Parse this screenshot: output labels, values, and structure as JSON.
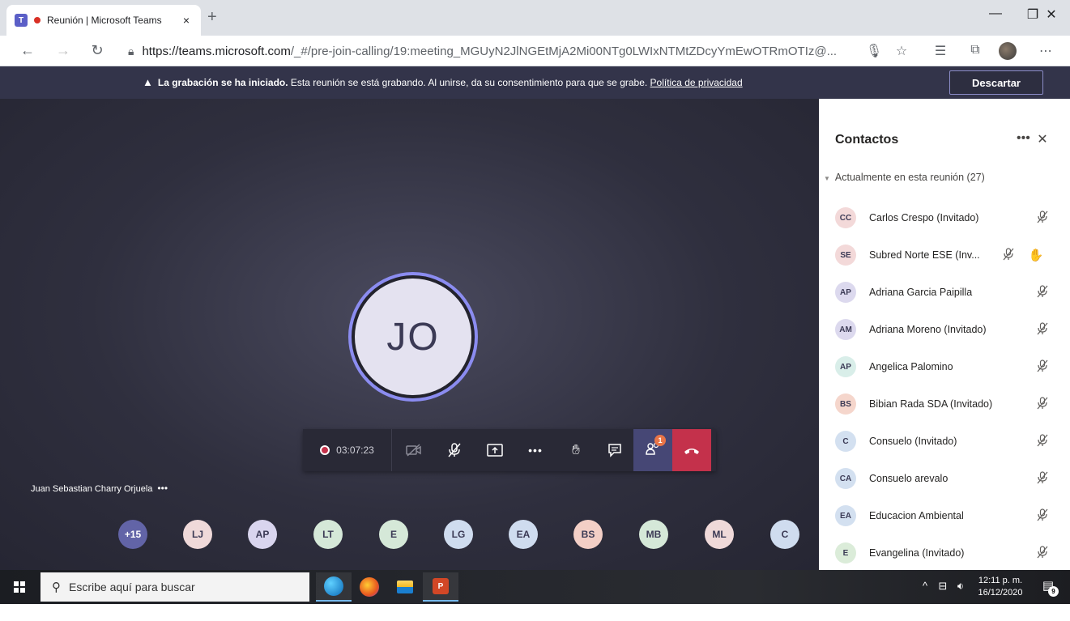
{
  "browser": {
    "tab_title": "Reunión | Microsoft Teams",
    "tab_close": "×",
    "new_tab": "+",
    "url_host": "https://teams.microsoft.com",
    "url_path": "/_#/pre-join-calling/19:meeting_MGUyN2JlNGEtMjA2Mi00NTg0LWIxNTMtZDcyYmEwOTRmOTIz@...",
    "icons": [
      "back-icon",
      "forward-icon",
      "refresh-icon",
      "lock-icon",
      "microphone-icon",
      "star-icon",
      "favorites-icon",
      "collections-icon",
      "more-icon"
    ]
  },
  "banner": {
    "bold_text": "La grabación se ha iniciado.",
    "text": " Esta reunión se está grabando. Al unirse, da su consentimiento para que se grabe. ",
    "link": "Política de privacidad",
    "dismiss_label": "Descartar"
  },
  "meeting": {
    "main_initials": "JO",
    "timer": "03:07:23",
    "people_badge": "1",
    "presenter_name": "Juan Sebastian Charry Orjuela",
    "presenter_more": "•••",
    "roster": [
      {
        "initials": "+15",
        "color": "#6264a7",
        "text_color": "#ffffff"
      },
      {
        "initials": "LJ",
        "color": "#efd9d9",
        "text_color": "#3b3a55"
      },
      {
        "initials": "AP",
        "color": "#d9d5ee",
        "text_color": "#3b3a55"
      },
      {
        "initials": "LT",
        "color": "#d5e8d8",
        "text_color": "#3b3a55"
      },
      {
        "initials": "E",
        "color": "#d5e8d8",
        "text_color": "#3b3a55"
      },
      {
        "initials": "LG",
        "color": "#cfdcef",
        "text_color": "#3b3a55"
      },
      {
        "initials": "EA",
        "color": "#cfdcef",
        "text_color": "#3b3a55"
      },
      {
        "initials": "BS",
        "color": "#f3cfc6",
        "text_color": "#3b3a55"
      },
      {
        "initials": "MB",
        "color": "#d5e8d8",
        "text_color": "#3b3a55"
      },
      {
        "initials": "ML",
        "color": "#efd9d9",
        "text_color": "#3b3a55"
      },
      {
        "initials": "C",
        "color": "#cfdcef",
        "text_color": "#3b3a55"
      }
    ]
  },
  "panel": {
    "title": "Contactos",
    "more": "•••",
    "close": "✕",
    "section": "Actualmente en esta reunión (27)",
    "participants": [
      {
        "initials": "CC",
        "name": "Carlos Crespo (Invitado)",
        "color": "#f3d9d9"
      },
      {
        "initials": "SE",
        "name": "Subred Norte ESE (Inv...",
        "color": "#f3d9d9"
      },
      {
        "initials": "AP",
        "name": "Adriana Garcia Paipilla",
        "color": "#dcd9ee"
      },
      {
        "initials": "AM",
        "name": "Adriana Moreno (Invitado)",
        "color": "#dcd9ee"
      },
      {
        "initials": "AP",
        "name": "Angelica Palomino",
        "color": "#d9eee9"
      },
      {
        "initials": "BS",
        "name": "Bibian Rada SDA (Invitado)",
        "color": "#f5d6cc"
      },
      {
        "initials": "C",
        "name": "Consuelo (Invitado)",
        "color": "#d3e0f0"
      },
      {
        "initials": "CA",
        "name": "Consuelo arevalo",
        "color": "#d3e0f0"
      },
      {
        "initials": "EA",
        "name": "Educacion Ambiental",
        "color": "#d3e0f0"
      },
      {
        "initials": "E",
        "name": "Evangelina (Invitado)",
        "color": "#dbecd9"
      }
    ]
  },
  "taskbar": {
    "search_placeholder": "Escribe aquí para buscar",
    "time": "12:11 p. m.",
    "date": "16/12/2020",
    "notification_count": "9"
  }
}
